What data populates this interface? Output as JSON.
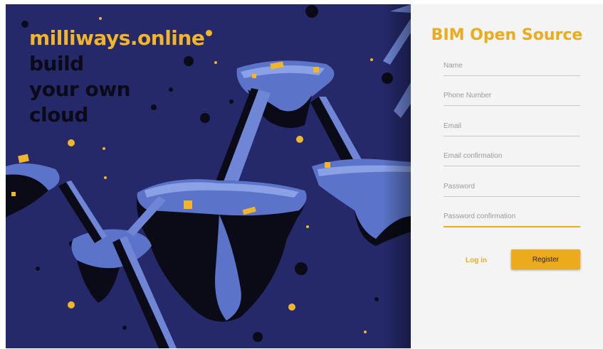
{
  "hero": {
    "brand": "milliways.online",
    "tagline_lines": [
      "build",
      "your own",
      "cloud"
    ]
  },
  "form": {
    "title": "BIM Open Source",
    "fields": [
      {
        "placeholder": "Name",
        "value": ""
      },
      {
        "placeholder": "Phone Number",
        "value": ""
      },
      {
        "placeholder": "Email",
        "value": ""
      },
      {
        "placeholder": "Email confirmation",
        "value": ""
      },
      {
        "placeholder": "Password",
        "value": ""
      },
      {
        "placeholder": "Password confirmation",
        "value": ""
      }
    ],
    "login_label": "Log in",
    "register_label": "Register"
  },
  "colors": {
    "accent": "#ecab1c",
    "hero_background": "#25296a",
    "panel_background": "#f4f4f4"
  }
}
